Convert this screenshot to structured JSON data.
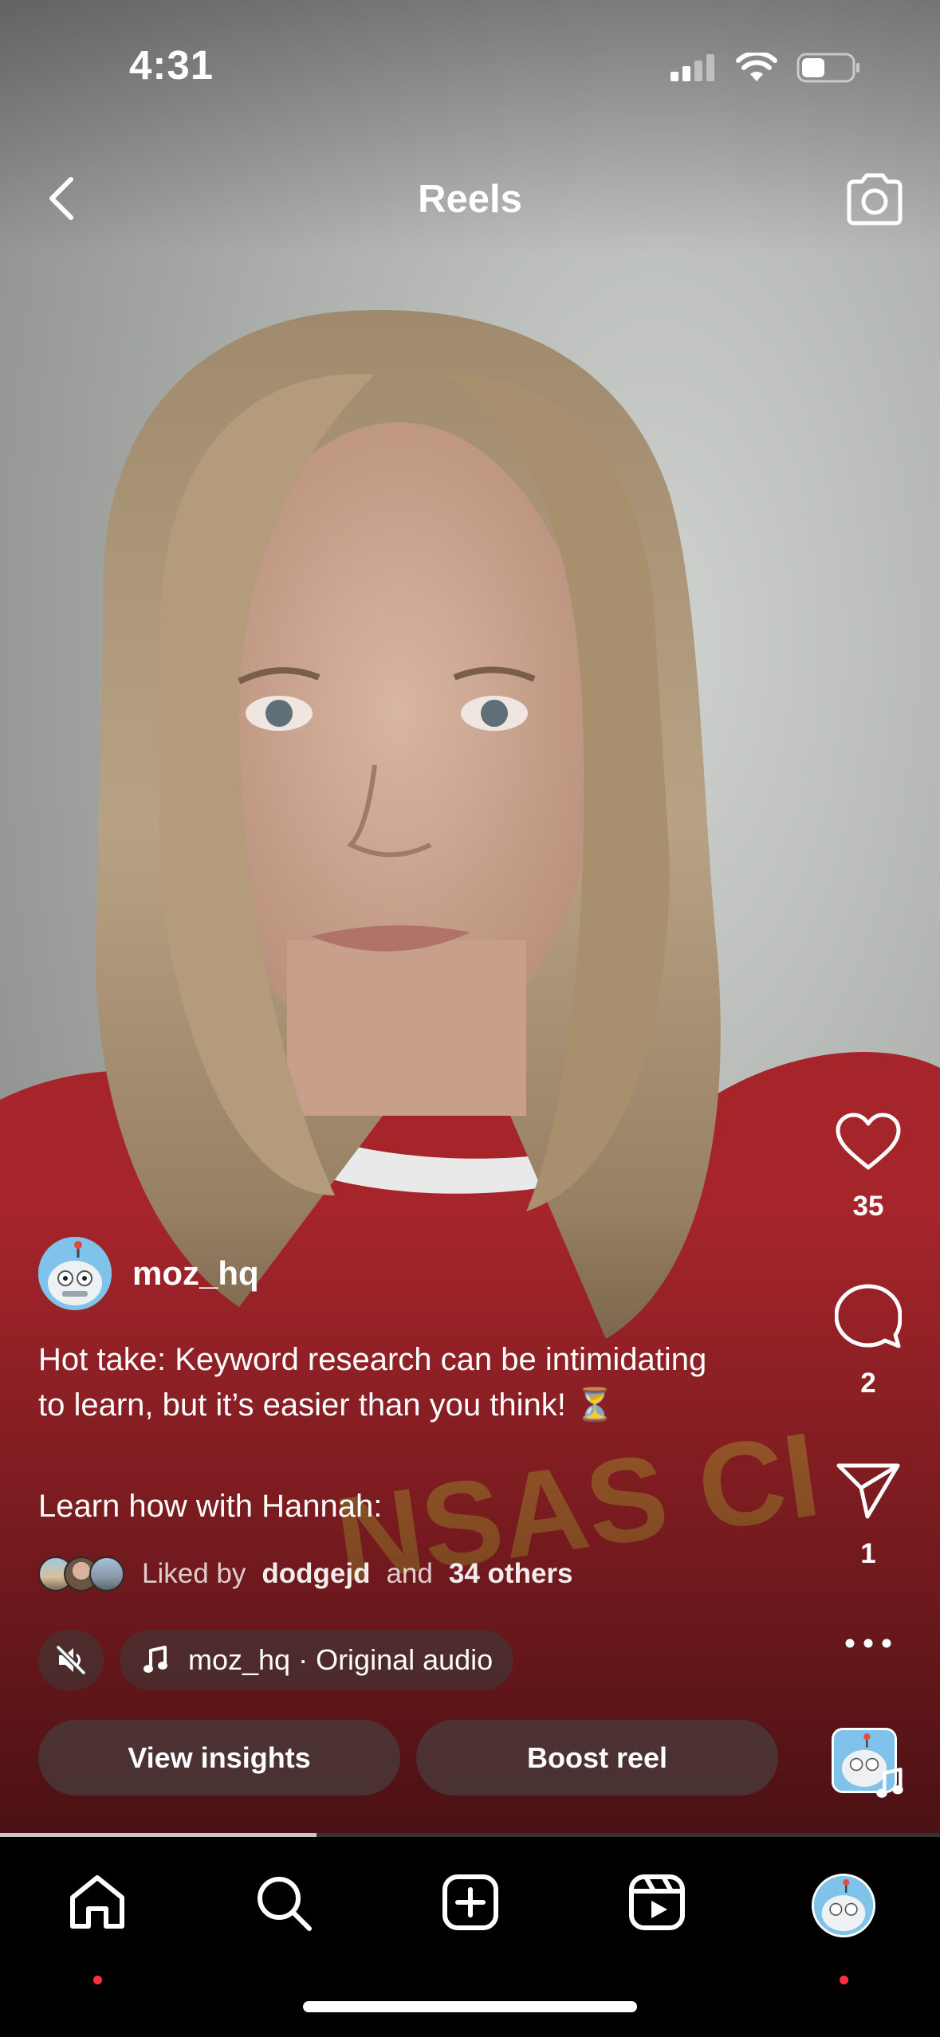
{
  "status_bar": {
    "time": "4:31"
  },
  "nav": {
    "title": "Reels"
  },
  "post": {
    "username": "moz_hq",
    "caption_line1": "Hot take: Keyword research can be intimidating",
    "caption_line2": "to learn, but it’s easier than you think! ⏳",
    "caption_line3": "Learn how with Hannah:",
    "liked_prefix": "Liked by",
    "liked_user": "dodgejd",
    "liked_and": "and",
    "liked_others": "34 others",
    "audio_label": "moz_hq · Original audio"
  },
  "actions": {
    "insights": "View insights",
    "boost": "Boost reel"
  },
  "rail": {
    "likes": "35",
    "comments": "2",
    "shares": "1"
  },
  "progress": {
    "fraction": 0.337
  },
  "colors": {
    "notification_dot": "#ff3040",
    "avatar_bg": "#7fc2ea"
  },
  "icons": [
    "back-icon",
    "camera-icon",
    "heart-icon",
    "comment-icon",
    "share-icon",
    "more-icon",
    "mute-icon",
    "music-note-icon",
    "home-icon",
    "search-icon",
    "create-icon",
    "reels-icon",
    "profile-icon"
  ]
}
